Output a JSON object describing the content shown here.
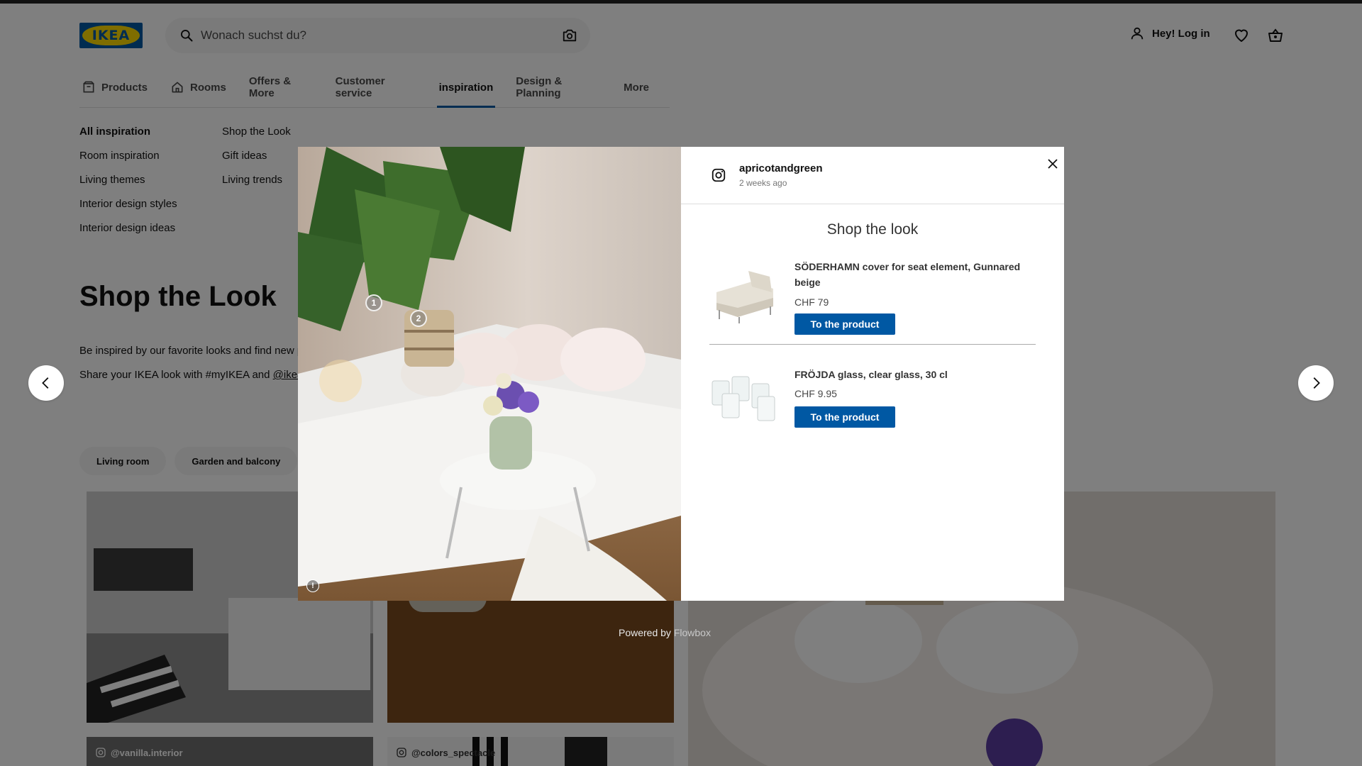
{
  "header": {
    "logo_text": "IKEA",
    "search_placeholder": "Wonach suchst du?",
    "login_label": "Hey! Log in"
  },
  "nav": {
    "items": [
      {
        "label": "Products",
        "icon": "box-icon"
      },
      {
        "label": "Rooms",
        "icon": "house-icon"
      },
      {
        "label": "Offers & More"
      },
      {
        "label": "Customer service"
      },
      {
        "label": "inspiration",
        "active": true
      },
      {
        "label": "Design & Planning"
      },
      {
        "label": "More"
      }
    ]
  },
  "subnav": {
    "col1": [
      "All inspiration",
      "Room inspiration",
      "Living themes",
      "Interior design styles",
      "Interior design ideas"
    ],
    "col2": [
      "Shop the Look",
      "Gift ideas",
      "Living trends"
    ]
  },
  "hero": {
    "title": "Shop the Look",
    "line1": "Be inspired by our favorite looks and find new p",
    "line2_prefix": "Share your IKEA look with #myIKEA and ",
    "line2_link": "@ikeas"
  },
  "pills": [
    "Living room",
    "Garden and balcony"
  ],
  "gallery": {
    "credits": [
      "@vanilla.interior",
      "@colors_spectacle"
    ]
  },
  "powered_by": {
    "prefix": "Powered by ",
    "brand": "Flowbox"
  },
  "modal": {
    "author": "apricotandgreen",
    "time": "2 weeks ago",
    "look_title": "Shop the look",
    "hotspots": [
      "1",
      "2"
    ],
    "report_glyph": "!",
    "products": [
      {
        "name": "SÖDERHAMN cover for seat element, Gunnared beige",
        "price": "CHF 79",
        "button": "To the product"
      },
      {
        "name": "FRÖJDA glass, clear glass, 30 cl",
        "price": "CHF 9.95",
        "button": "To the product"
      }
    ]
  },
  "colors": {
    "ikea_blue": "#0058a3",
    "ikea_yellow": "#ffdb00"
  }
}
